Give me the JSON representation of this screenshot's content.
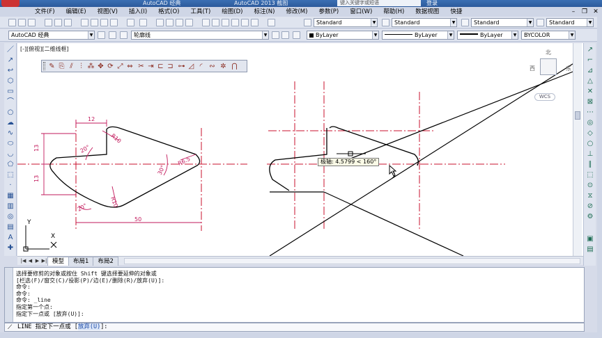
{
  "window": {
    "app_menu_label": "",
    "title_left": "AutoCAD 经典",
    "title_center": "AutoCAD 2013  截图",
    "search_placeholder": "键入关键字或短语",
    "user": "登录"
  },
  "menubar": {
    "items": [
      "文件(F)",
      "编辑(E)",
      "视图(V)",
      "插入(I)",
      "格式(O)",
      "工具(T)",
      "绘图(D)",
      "标注(N)",
      "修改(M)",
      "参数(P)",
      "窗口(W)",
      "帮助(H)",
      "数据视图",
      "快捷"
    ]
  },
  "toolbar_std": {
    "style1": "Standard",
    "style2": "Standard",
    "style3": "Standard",
    "style4": "Standard"
  },
  "toolbar_layers": {
    "workspace": "AutoCAD 经典",
    "layer": "轮廓线",
    "color": "ByLayer",
    "linetype": "ByLayer",
    "lineweight": "ByLayer",
    "plotstyle": "BYCOLOR"
  },
  "viewport": {
    "label": "[-][俯视][二维线框]"
  },
  "viewcube": {
    "north": "北",
    "east": "东",
    "west": "西",
    "wcs": "WCS"
  },
  "tooltip": {
    "text": "极轴: 4.5799 < 160°"
  },
  "dimensions": {
    "top_width": "12",
    "left_upper": "13",
    "left_lower": "13",
    "bottom_width": "50",
    "angle_top": "20°",
    "angle_bottom": "20°",
    "angle_right": "30°",
    "radius_right": "R6.5",
    "radius_left": "R10",
    "radius_center": "R10"
  },
  "ucs": {
    "x_label": "X",
    "y_label": "Y"
  },
  "tabs": [
    "模型",
    "布局1",
    "布局2"
  ],
  "command_history": [
    "选择要修剪的对象或按住 Shift 键选择要延伸的对象或",
    "[栏选(F)/窗交(C)/投影(P)/边(E)/删除(R)/放弃(U)]:",
    "命令:",
    "命令:",
    "命令: _line",
    "指定第一个点:",
    "指定下一点或 [放弃(U)]:"
  ],
  "command_prompt": {
    "prefix": "LINE 指定下一点或 [",
    "option": "放弃(U)",
    "suffix": "]:"
  },
  "colors": {
    "centerline": "#c8102e",
    "dimension": "#c2185b",
    "geometry": "#000000",
    "accent": "#2c5a9c"
  }
}
